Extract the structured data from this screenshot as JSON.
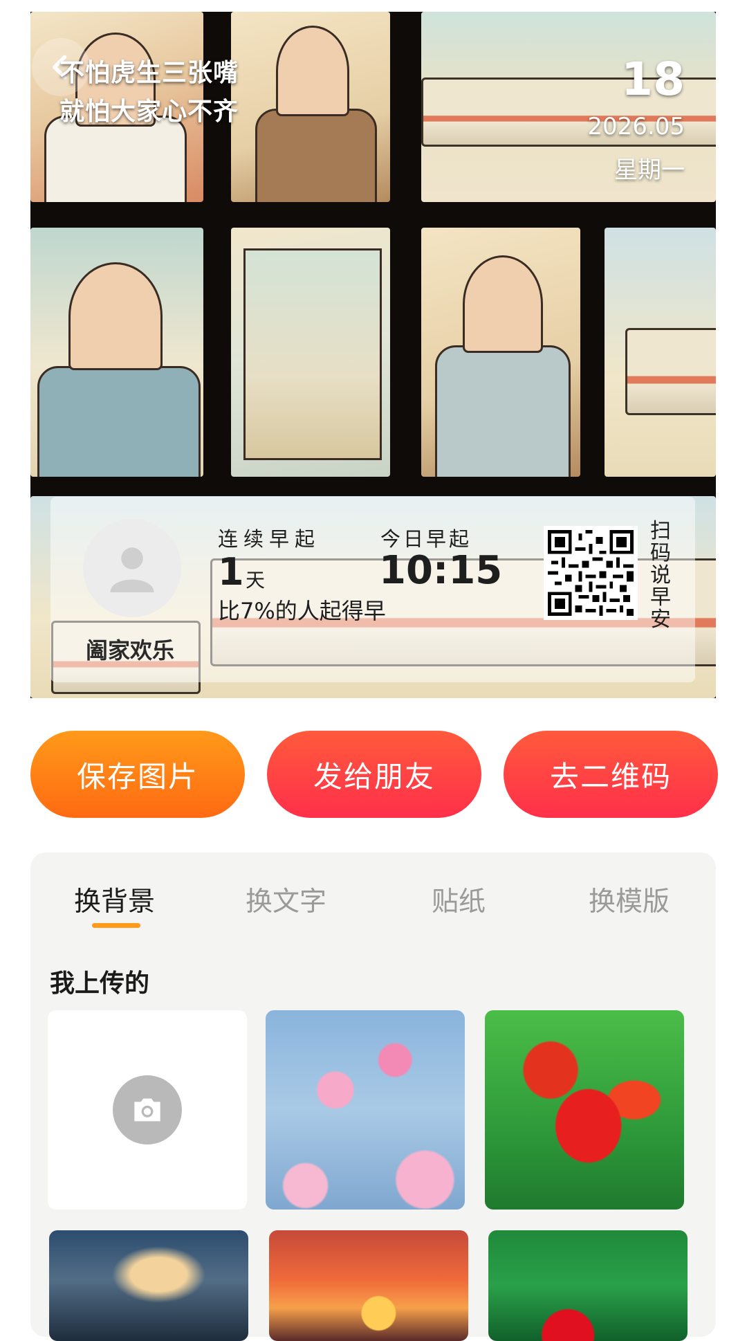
{
  "poster": {
    "quote_line1": "不怕虎生三张嘴",
    "quote_line2": "就怕大家心不齐",
    "date_day": "18",
    "date_year_month": "2026.05",
    "date_weekday": "星期一",
    "username": "阖家欢乐",
    "streak_label": "连续早起",
    "streak_value": "1",
    "streak_unit": "天",
    "percent_text": "比7%的人起得早",
    "wake_label": "今日早起",
    "wake_time": "10:15",
    "qr_caption": "扫码说早安"
  },
  "actions": {
    "save": "保存图片",
    "send": "发给朋友",
    "qrcode": "去二维码"
  },
  "tabs": [
    {
      "label": "换背景",
      "active": true
    },
    {
      "label": "换文字",
      "active": false
    },
    {
      "label": "贴纸",
      "active": false
    },
    {
      "label": "换模版",
      "active": false
    }
  ],
  "section": {
    "title": "我上传的"
  },
  "icons": {
    "back": "back-arrow-icon",
    "avatar": "person-icon",
    "upload": "camera-icon"
  },
  "colors": {
    "accent_orange": "#ff7a12",
    "accent_red": "#ff3a46",
    "tab_underline": "#ff9a1a"
  }
}
